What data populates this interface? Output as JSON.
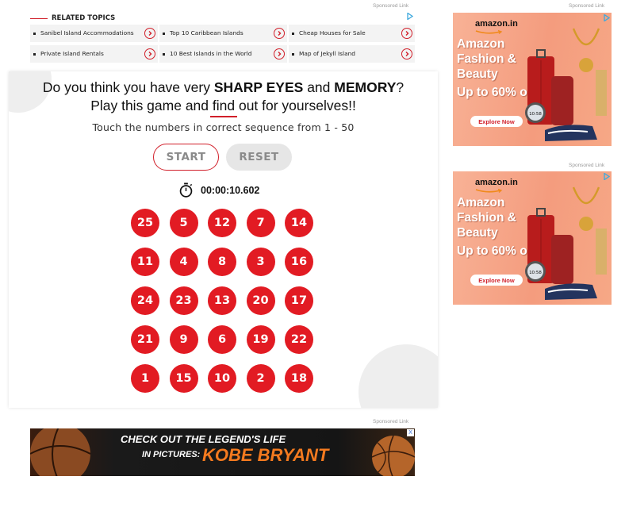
{
  "related": {
    "sponsored_label": "Sponsored Link",
    "heading": "RELATED TOPICS",
    "topics": [
      {
        "label": "Sanibel Island Accommodations",
        "icon": "chevron-right-icon"
      },
      {
        "label": "Top 10 Caribbean Islands",
        "icon": "chevron-right-icon"
      },
      {
        "label": "Cheap Houses for Sale",
        "icon": "chevron-right-icon"
      },
      {
        "label": "Private Island Rentals",
        "icon": "chevron-right-icon"
      },
      {
        "label": "10 Best Islands in the World",
        "icon": "chevron-right-icon"
      },
      {
        "label": "Map of Jekyll Island",
        "icon": "chevron-right-icon"
      }
    ]
  },
  "game": {
    "question_prefix": "Do you think you have very ",
    "question_bold1": "SHARP EYES",
    "question_mid": " and ",
    "question_bold2": "MEMORY",
    "question_suffix": "?",
    "question_line2": "Play this game and find out for yourselves!!",
    "instruction": "Touch the numbers in correct sequence from 1 - 50",
    "start_label": "START",
    "reset_label": "RESET",
    "timer": "00:00:10.602",
    "numbers": [
      [
        "25",
        "5",
        "12",
        "7",
        "14"
      ],
      [
        "11",
        "4",
        "8",
        "3",
        "16"
      ],
      [
        "24",
        "23",
        "13",
        "20",
        "17"
      ],
      [
        "21",
        "9",
        "6",
        "19",
        "22"
      ],
      [
        "1",
        "15",
        "10",
        "2",
        "18"
      ]
    ],
    "accent_color": "#e21b23"
  },
  "ads": {
    "sponsored_label": "Sponsored Link",
    "amazon": {
      "logo": "amazon.in",
      "headline": [
        "Amazon",
        "Fashion &",
        "Beauty",
        "Up to 60% off"
      ],
      "cta": "Explore Now",
      "watch_time": "10:58"
    },
    "kobe": {
      "line1": "CHECK OUT THE LEGEND'S LIFE",
      "line2": "IN PICTURES:",
      "line3": "KOBE BRYANT",
      "close": "X"
    }
  }
}
